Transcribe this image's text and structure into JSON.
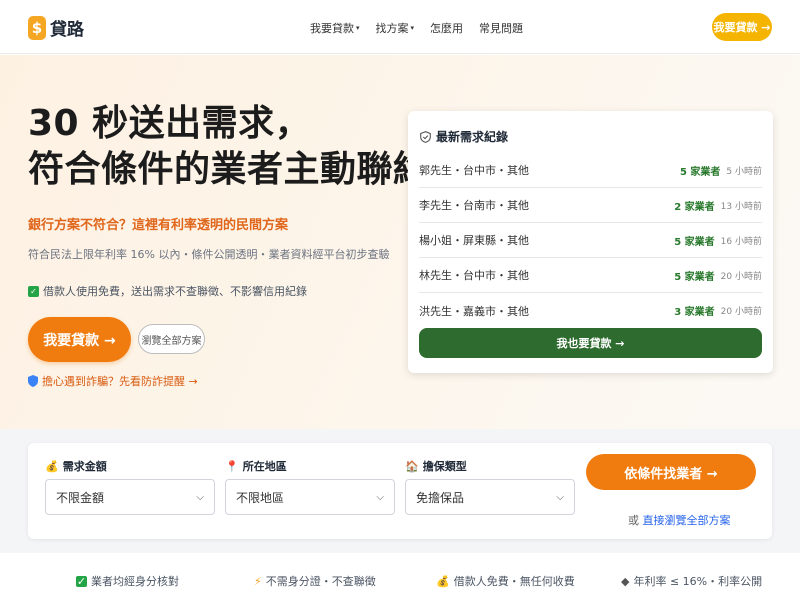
{
  "header": {
    "logo_glyph": "$",
    "logo_text": "貸路",
    "nav": [
      {
        "label": "我要貸款",
        "caret": "▾"
      },
      {
        "label": "找方案",
        "caret": "▾"
      },
      {
        "label": "怎麼用",
        "caret": ""
      },
      {
        "label": "常見問題",
        "caret": ""
      }
    ],
    "cta_label": "我要貸款 →"
  },
  "hero": {
    "title_line1": "30 秒送出需求，",
    "title_line2": "符合條件的業者主動聯絡你",
    "subtitle": "銀行方案不符合？這裡有利率透明的民間方案",
    "description": "符合民法上限年利率 16% 以內・條件公開透明・業者資料經平台初步查驗",
    "note": "借款人使用免費，送出需求不查聯徵、不影響信用紀錄",
    "primary_button": "我要貸款 →",
    "outline_button": "瀏覽全部方案",
    "scam_link": "擔心遇到詐騙？先看防詐提醒 →"
  },
  "records": {
    "title": "最新需求紀錄",
    "items": [
      {
        "name": "郭先生・台中市・其他",
        "count": "5 家業者",
        "time": "5 小時前"
      },
      {
        "name": "李先生・台南市・其他",
        "count": "2 家業者",
        "time": "13 小時前"
      },
      {
        "name": "楊小姐・屏東縣・其他",
        "count": "5 家業者",
        "time": "16 小時前"
      },
      {
        "name": "林先生・台中市・其他",
        "count": "5 家業者",
        "time": "20 小時前"
      },
      {
        "name": "洪先生・嘉義市・其他",
        "count": "3 家業者",
        "time": "20 小時前"
      }
    ],
    "button": "我也要貸款 →"
  },
  "search": {
    "fields": [
      {
        "label": "需求金額",
        "value": "不限金額"
      },
      {
        "label": "所在地區",
        "value": "不限地區"
      },
      {
        "label": "擔保類型",
        "value": "免擔保品"
      }
    ],
    "button": "依條件找業者 →",
    "browse_prefix": "或 ",
    "browse_link": "直接瀏覽全部方案"
  },
  "features": [
    "業者均經身分核對",
    "不需身分證・不查聯徵",
    "借款人免費・無任何收費",
    "年利率 ≤ 16%・利率公開"
  ],
  "colors": {
    "brand_orange": "#f07c10",
    "brand_yellow": "#f5b400",
    "accent_green": "#2e6b2f",
    "count_green": "#2a7a2e",
    "link_blue": "#2563eb"
  }
}
